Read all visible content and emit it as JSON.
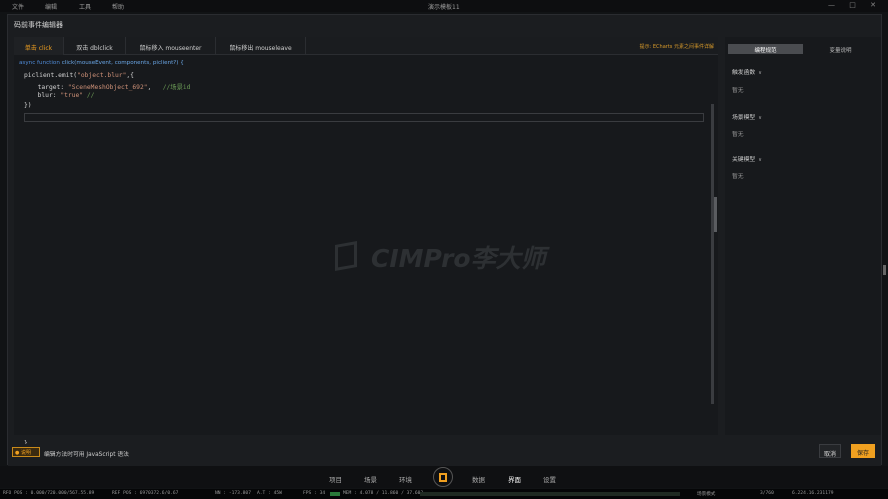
{
  "menubar": {
    "items": [
      "文件",
      "编辑",
      "工具",
      "帮助"
    ],
    "title": "演示模板11",
    "window_buttons": [
      "—",
      "□",
      "✕"
    ]
  },
  "dialog": {
    "title": "码前事件编辑器",
    "tabs": [
      {
        "label": "单击 click",
        "active": true
      },
      {
        "label": "双击 dblclick",
        "active": false
      },
      {
        "label": "鼠标移入 mouseenter",
        "active": false
      },
      {
        "label": "鼠标移出 mouseleave",
        "active": false
      }
    ],
    "hint_link": "提示: ECharts 元素之间事件详解",
    "editor": {
      "signature_kw": "async function",
      "signature_fn": "click(mouseEvent, components, piclient?) {",
      "line1_a": "piclient.emit(",
      "line1_str": "\"object.blur\"",
      "line1_b": ",{",
      "line2_a": "  target: ",
      "line2_str": "\"SceneMeshObject_692\"",
      "line2_b": ",   ",
      "line2_cmt": "//场景id",
      "line3_a": "  blur: ",
      "line3_str": "\"true\"",
      "line3_cmt": " //",
      "line4": "})",
      "end_brace": "}"
    },
    "watermark": "CIMPro李大师",
    "side": {
      "tabs": [
        {
          "label": "编程规范",
          "active": true
        },
        {
          "label": "变量说明",
          "active": false
        }
      ],
      "sections": [
        {
          "title": "触发函数",
          "value": "暂无"
        },
        {
          "title": "场景模型",
          "value": "暂无"
        },
        {
          "title": "关键模型",
          "value": "暂无"
        }
      ]
    },
    "tip_badge": "说明",
    "tip_text": "编辑方法时可用 JavaScript 语法",
    "cancel_label": "取消",
    "save_label": "保存"
  },
  "bottom_nav": {
    "items": [
      "项目",
      "场景",
      "环境",
      "数据",
      "界面",
      "设置"
    ],
    "active": "界面"
  },
  "statusbar": {
    "seg1": "RFO POS : 0.000/720.000/567.55.89",
    "seg2": "REF POS : 6970372.6/0.67",
    "seg3": "NN : -173.807",
    "seg4": "A.T : 45W",
    "seg5": "FPS : 34",
    "seg6": "MEM : 4.078 / 11.860 / 37.603",
    "seg7": "场景模式",
    "seg8": "3/760",
    "seg9": "6.224.16.231179"
  },
  "colors": {
    "accent": "#f0a020",
    "bg": "#111315",
    "panel": "#17191c"
  }
}
